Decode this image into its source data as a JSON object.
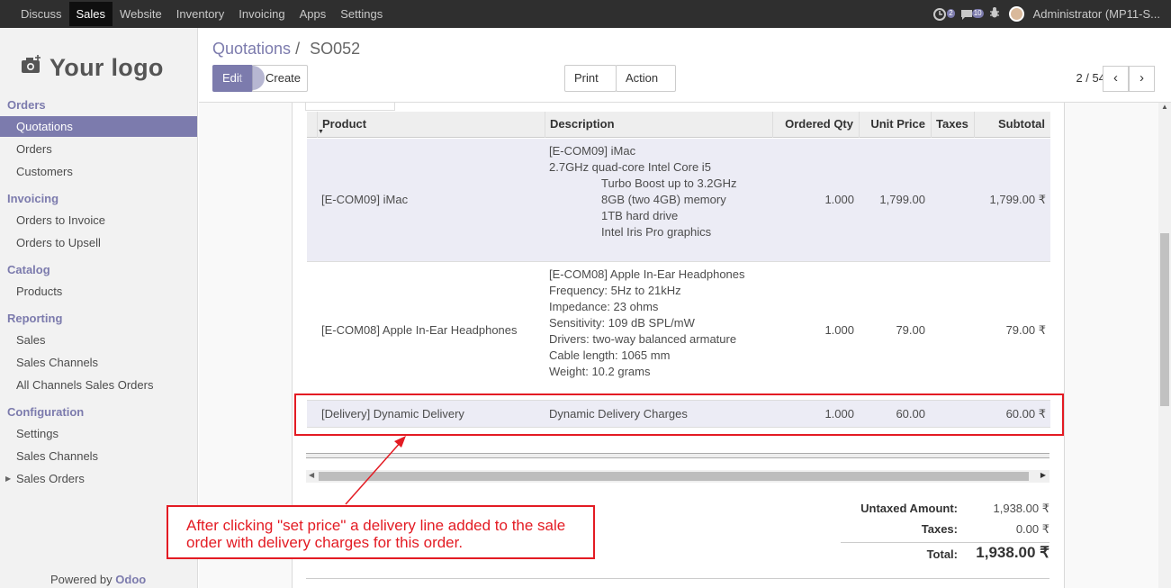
{
  "topbar": {
    "menu": [
      "Discuss",
      "Sales",
      "Website",
      "Inventory",
      "Invoicing",
      "Apps",
      "Settings"
    ],
    "active_index": 1,
    "activity_count": "2",
    "messages_count": "10",
    "user": "Administrator (MP11-S..."
  },
  "sidebar": {
    "logo_text": "Your logo",
    "sections": [
      {
        "title": "Orders",
        "items": [
          "Quotations",
          "Orders",
          "Customers"
        ]
      },
      {
        "title": "Invoicing",
        "items": [
          "Orders to Invoice",
          "Orders to Upsell"
        ]
      },
      {
        "title": "Catalog",
        "items": [
          "Products"
        ]
      },
      {
        "title": "Reporting",
        "items": [
          "Sales",
          "Sales Channels",
          "All Channels Sales Orders"
        ]
      },
      {
        "title": "Configuration",
        "items": [
          "Settings",
          "Sales Channels",
          "Sales Orders"
        ]
      }
    ],
    "powered_by": "Powered by",
    "powered_brand": "Odoo"
  },
  "control": {
    "breadcrumb_parent": "Quotations",
    "breadcrumb_sep": "/",
    "breadcrumb_current": "SO052",
    "edit_label": "Edit",
    "create_label": "Create",
    "print_label": "Print",
    "action_label": "Action",
    "pager": "2 / 54"
  },
  "table": {
    "headers": [
      "Product",
      "Description",
      "Ordered Qty",
      "Unit Price",
      "Taxes",
      "Subtotal"
    ],
    "rows": [
      {
        "product": "[E-COM09] iMac",
        "description": [
          "[E-COM09] iMac",
          "2.7GHz quad-core Intel Core i5",
          "Turbo Boost up to 3.2GHz",
          "8GB (two 4GB) memory",
          "1TB hard drive",
          "Intel Iris Pro graphics"
        ],
        "qty": "1.000",
        "price": "1,799.00",
        "subtotal": "1,799.00 ₹"
      },
      {
        "product": "[E-COM08] Apple In-Ear Headphones",
        "description": [
          "[E-COM08] Apple In-Ear Headphones",
          "Frequency: 5Hz to 21kHz",
          "Impedance: 23 ohms",
          "Sensitivity: 109 dB SPL/mW",
          "Drivers: two-way balanced armature",
          "Cable length: 1065 mm",
          "Weight: 10.2 grams"
        ],
        "qty": "1.000",
        "price": "79.00",
        "subtotal": "79.00 ₹"
      },
      {
        "product": "[Delivery] Dynamic Delivery",
        "description": [
          "Dynamic Delivery Charges"
        ],
        "qty": "1.000",
        "price": "60.00",
        "subtotal": "60.00 ₹"
      }
    ]
  },
  "totals": {
    "untaxed_label": "Untaxed Amount:",
    "untaxed": "1,938.00 ₹",
    "taxes_label": "Taxes:",
    "taxes": "0.00 ₹",
    "total_label": "Total:",
    "total": "1,938.00 ₹"
  },
  "annotation": {
    "text": "After clicking \"set price\" a delivery line added to the sale order with delivery charges for this order.",
    "color": "#e31b23"
  },
  "colors": {
    "brand": "#7c7bad",
    "topbar": "#2f2f2f"
  }
}
